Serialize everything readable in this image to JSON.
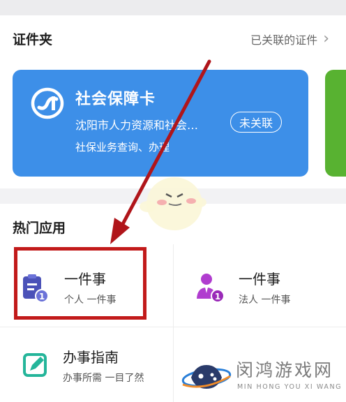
{
  "certificates": {
    "title": "证件夹",
    "linked_label": "已关联的证件",
    "card": {
      "title": "社会保障卡",
      "org": "沈阳市人力资源和社会…",
      "status": "未关联",
      "desc": "社保业务查询、办理"
    }
  },
  "hot_apps": {
    "title": "热门应用",
    "items": [
      {
        "title": "一件事",
        "sub": "个人 一件事"
      },
      {
        "title": "一件事",
        "sub": "法人 一件事"
      },
      {
        "title": "办事指南",
        "sub": "办事所需 一目了然"
      }
    ]
  },
  "watermark": {
    "title": "闵鸿游戏网",
    "sub": "MIN HONG YOU XI WANG"
  },
  "colors": {
    "card_blue": "#3d8fe8",
    "card_green": "#58b231",
    "highlight_red": "#c21a1a",
    "icon_purple": "#b03ccf",
    "icon_indigo": "#4b52b8",
    "icon_teal": "#24b59a"
  }
}
